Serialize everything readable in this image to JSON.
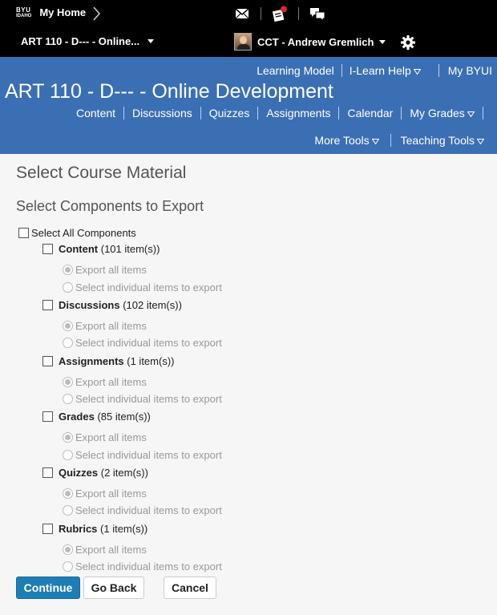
{
  "topbar": {
    "logo_line1": "BYU",
    "logo_line2": "IDAHO",
    "home_label": "My Home",
    "course_selector": "ART 110 - D--- - Online...",
    "user_name": "CCT - Andrew Gremlich",
    "icons": [
      "mail-icon",
      "notifications-icon",
      "chat-icon",
      "gear-icon"
    ],
    "notification_dot_color": "#e0242c"
  },
  "header": {
    "util_links": [
      "Learning Model",
      "I-Learn Help",
      "My BYUI"
    ],
    "course_title": "ART 110 - D--- - Online Development",
    "nav": [
      "Content",
      "Discussions",
      "Quizzes",
      "Assignments",
      "Calendar",
      "My Grades"
    ],
    "subnav": [
      "More Tools",
      "Teaching Tools"
    ],
    "band_color": "#3b6fb4"
  },
  "main": {
    "page_title": "Select Course Material",
    "section_title": "Select Components to Export",
    "select_all_label": "Select All Components",
    "components": [
      {
        "name": "Content",
        "count": "(101 item(s))"
      },
      {
        "name": "Discussions",
        "count": "(102 item(s))"
      },
      {
        "name": "Assignments",
        "count": "(1 item(s))"
      },
      {
        "name": "Grades",
        "count": "(85 item(s))"
      },
      {
        "name": "Quizzes",
        "count": "(2 item(s))"
      },
      {
        "name": "Rubrics",
        "count": "(1 item(s))"
      }
    ],
    "option_all": "Export all items",
    "option_individual": "Select individual items to export"
  },
  "buttons": {
    "continue": "Continue",
    "go_back": "Go Back",
    "cancel": "Cancel"
  }
}
